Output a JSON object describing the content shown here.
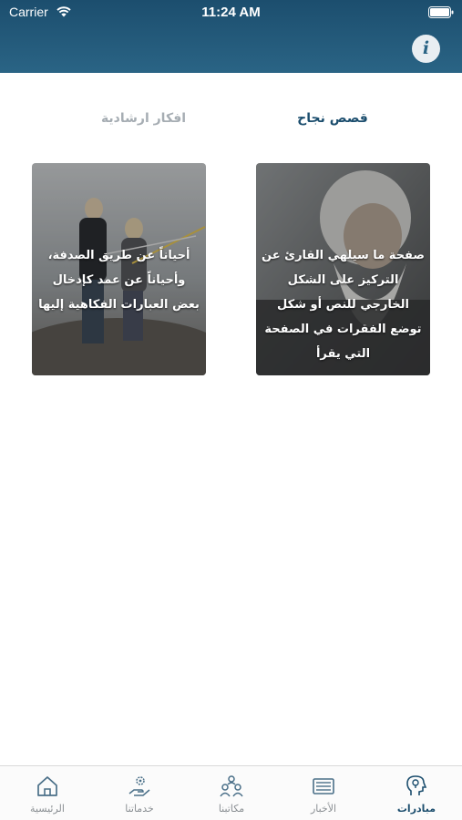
{
  "status": {
    "carrier": "Carrier",
    "time": "11:24 AM"
  },
  "header": {
    "info_glyph": "i",
    "info_icon": "info-icon"
  },
  "tabs": [
    {
      "label": "قصص نجاح",
      "active": true
    },
    {
      "label": "افكار ارشادية",
      "active": false
    }
  ],
  "cards": [
    {
      "text": "صفحة ما سيلهي القارئ عن التركيز على الشكل الخارجي للنص أو شكل توضع الفقرات في الصفحة التي يقرأ"
    },
    {
      "text": "أحياناً عن طريق الصدفة، وأحياناً عن عمد كإدخال بعض العبارات الفكاهية إليها"
    }
  ],
  "tabbar": [
    {
      "label": "مبادرات",
      "icon": "head-idea-icon",
      "active": true
    },
    {
      "label": "الأخبار",
      "icon": "newspaper-icon",
      "active": false
    },
    {
      "label": "مكاتبنا",
      "icon": "team-icon",
      "active": false
    },
    {
      "label": "خدماتنا",
      "icon": "hand-gear-icon",
      "active": false
    },
    {
      "label": "الرئيسية",
      "icon": "home-icon",
      "active": false
    }
  ],
  "colors": {
    "primary": "#1c4e6e",
    "header": "#2a6485",
    "inactive": "#a6adb3"
  }
}
